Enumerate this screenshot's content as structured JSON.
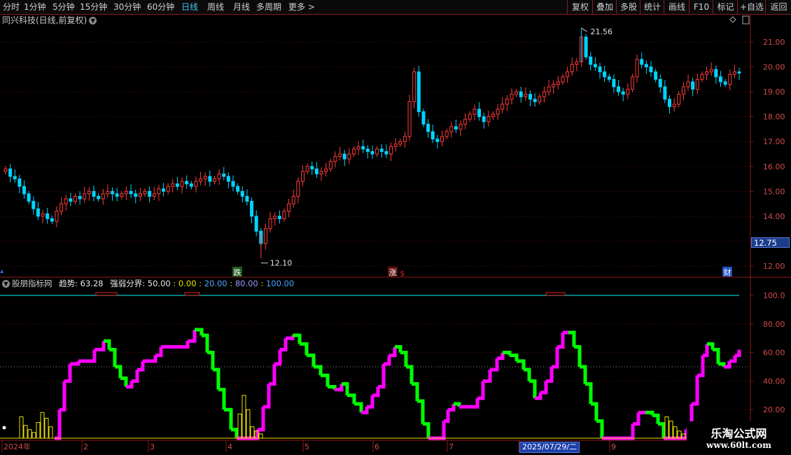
{
  "period_tabs": [
    {
      "label": "分时",
      "active": false
    },
    {
      "label": "1分钟",
      "active": false
    },
    {
      "label": "5分钟",
      "active": false
    },
    {
      "label": "15分钟",
      "active": false
    },
    {
      "label": "30分钟",
      "active": false
    },
    {
      "label": "60分钟",
      "active": false
    },
    {
      "label": "日线",
      "active": true
    },
    {
      "label": "周线",
      "active": false
    },
    {
      "label": "月线",
      "active": false
    },
    {
      "label": "多周期",
      "active": false
    },
    {
      "label": "更多 >",
      "active": false
    }
  ],
  "right_toolbar": [
    "复权",
    "叠加",
    "多股",
    "统计",
    "画线",
    "F10",
    "+自选",
    "返回"
  ],
  "stock": {
    "title": "同兴科技(日线,前复权)",
    "price_badge": "12.75"
  },
  "price_axis": {
    "ticks": [
      "21.00",
      "20.00",
      "19.00",
      "18.00",
      "17.00",
      "16.00",
      "15.00",
      "14.00",
      "13.00",
      "12.00"
    ],
    "ymin": 11.7,
    "ymax": 22.0
  },
  "annotations": {
    "high": "21.56",
    "low": "12.10",
    "markers": [
      {
        "text": "跌",
        "color": "#3a9b3a"
      },
      {
        "text": "涨",
        "color": "#b22222"
      },
      {
        "text": "$",
        "color": "#d02020"
      },
      {
        "text": "财",
        "color": "#1f4fbf"
      }
    ]
  },
  "indicator": {
    "name": "股朋指标网",
    "trend_label": "趋势: 63.28",
    "boundary_label": "强弱分界: 50.00",
    "levels": [
      "0.00",
      "20.00",
      "80.00",
      "100.00"
    ],
    "axis_ticks": [
      "100.0",
      "80.00",
      "60.00",
      "40.00",
      "20.00"
    ]
  },
  "time_axis": {
    "labels": [
      "2024年",
      "2",
      "3",
      "4",
      "5",
      "6",
      "7",
      "8",
      "9"
    ],
    "cursor_date": "2025/07/29/二"
  },
  "watermark": {
    "line1": "乐淘公式网",
    "line2": "www.60lt.com"
  },
  "colors": {
    "up": "#ff3b3b",
    "down": "#00d4ff",
    "trend_up": "#ff00ff",
    "trend_down": "#00ff00",
    "bars": "#e8e000",
    "line100": "#00c8c8",
    "axis": "#8b1a1a"
  },
  "chart_data": {
    "type": "candlestick",
    "candles_close": [
      15.9,
      15.6,
      15.5,
      15.2,
      14.9,
      14.6,
      14.3,
      14.0,
      14.1,
      13.9,
      13.8,
      14.2,
      14.5,
      14.7,
      14.6,
      14.8,
      14.7,
      14.9,
      15.0,
      14.8,
      14.7,
      14.9,
      15.0,
      14.9,
      14.8,
      14.9,
      15.0,
      14.9,
      14.8,
      14.9,
      15.0,
      14.8,
      14.9,
      15.1,
      15.0,
      15.2,
      15.3,
      15.2,
      15.4,
      15.3,
      15.2,
      15.4,
      15.5,
      15.6,
      15.4,
      15.5,
      15.7,
      15.6,
      15.4,
      15.2,
      15.0,
      14.8,
      14.6,
      14.0,
      13.4,
      12.9,
      13.5,
      13.9,
      14.0,
      13.9,
      14.2,
      14.5,
      14.8,
      15.4,
      15.8,
      16.0,
      15.9,
      15.7,
      15.8,
      15.9,
      16.2,
      16.4,
      16.5,
      16.3,
      16.5,
      16.7,
      16.8,
      16.7,
      16.6,
      16.5,
      16.7,
      16.6,
      16.5,
      16.8,
      16.9,
      17.0,
      17.2,
      18.6,
      19.8,
      18.2,
      17.7,
      17.4,
      17.1,
      17.0,
      17.2,
      17.4,
      17.6,
      17.5,
      17.7,
      17.9,
      18.1,
      18.3,
      18.0,
      17.8,
      18.0,
      18.1,
      18.3,
      18.5,
      18.7,
      18.9,
      19.0,
      18.8,
      18.9,
      18.7,
      18.6,
      18.8,
      19.0,
      19.2,
      19.3,
      19.4,
      19.6,
      19.8,
      20.1,
      20.2,
      21.2,
      20.4,
      20.1,
      20.0,
      19.8,
      19.6,
      19.5,
      19.2,
      19.0,
      18.9,
      19.1,
      19.6,
      20.3,
      20.1,
      20.0,
      19.8,
      19.5,
      19.2,
      18.7,
      18.4,
      18.5,
      18.9,
      19.2,
      19.4,
      19.1,
      19.5,
      19.7,
      19.8,
      19.9,
      19.6,
      19.4,
      19.3,
      19.7,
      19.8,
      19.75
    ]
  }
}
